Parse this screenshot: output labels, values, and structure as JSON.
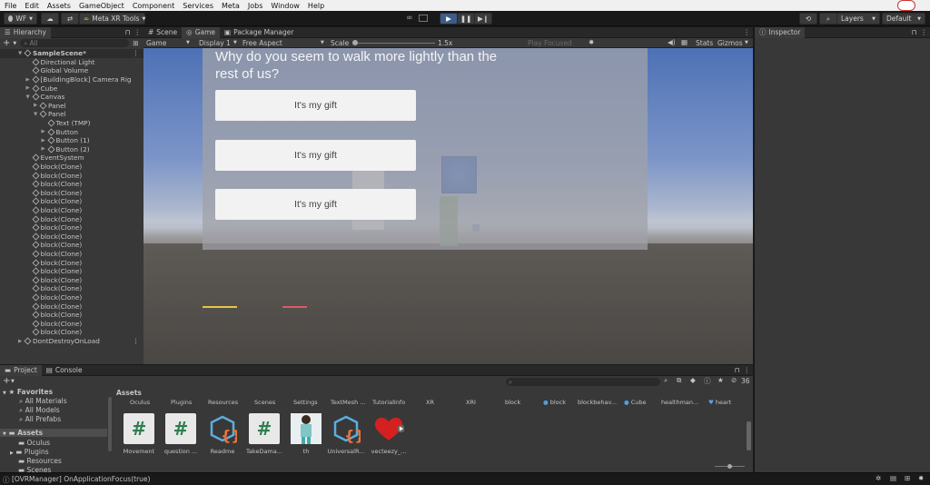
{
  "menubar": [
    "File",
    "Edit",
    "Assets",
    "GameObject",
    "Component",
    "Services",
    "Meta",
    "Jobs",
    "Window",
    "Help"
  ],
  "toolbar": {
    "account": "WF",
    "meta_tools": "Meta XR Tools",
    "layers": "Layers",
    "layout": "Default"
  },
  "hierarchy": {
    "title": "Hierarchy",
    "search": "All",
    "rows": [
      {
        "label": "SampleScene*",
        "indent": 0,
        "arrow": "▼",
        "bold": true
      },
      {
        "label": "Directional Light",
        "indent": 1,
        "arrow": ""
      },
      {
        "label": "Global Volume",
        "indent": 1,
        "arrow": ""
      },
      {
        "label": "[BuildingBlock] Camera Rig",
        "indent": 1,
        "arrow": "▶"
      },
      {
        "label": "Cube",
        "indent": 1,
        "arrow": "▶"
      },
      {
        "label": "Canvas",
        "indent": 1,
        "arrow": "▼"
      },
      {
        "label": "Panel",
        "indent": 2,
        "arrow": "▶"
      },
      {
        "label": "Panel",
        "indent": 2,
        "arrow": "▼"
      },
      {
        "label": "Text (TMP)",
        "indent": 3,
        "arrow": ""
      },
      {
        "label": "Button",
        "indent": 3,
        "arrow": "▶"
      },
      {
        "label": "Button (1)",
        "indent": 3,
        "arrow": "▶"
      },
      {
        "label": "Button (2)",
        "indent": 3,
        "arrow": "▶"
      },
      {
        "label": "EventSystem",
        "indent": 1,
        "arrow": ""
      },
      {
        "label": "block(Clone)",
        "indent": 1,
        "arrow": ""
      },
      {
        "label": "block(Clone)",
        "indent": 1,
        "arrow": ""
      },
      {
        "label": "block(Clone)",
        "indent": 1,
        "arrow": ""
      },
      {
        "label": "block(Clone)",
        "indent": 1,
        "arrow": ""
      },
      {
        "label": "block(Clone)",
        "indent": 1,
        "arrow": ""
      },
      {
        "label": "block(Clone)",
        "indent": 1,
        "arrow": ""
      },
      {
        "label": "block(Clone)",
        "indent": 1,
        "arrow": ""
      },
      {
        "label": "block(Clone)",
        "indent": 1,
        "arrow": ""
      },
      {
        "label": "block(Clone)",
        "indent": 1,
        "arrow": ""
      },
      {
        "label": "block(Clone)",
        "indent": 1,
        "arrow": ""
      },
      {
        "label": "block(Clone)",
        "indent": 1,
        "arrow": ""
      },
      {
        "label": "block(Clone)",
        "indent": 1,
        "arrow": ""
      },
      {
        "label": "block(Clone)",
        "indent": 1,
        "arrow": ""
      },
      {
        "label": "block(Clone)",
        "indent": 1,
        "arrow": ""
      },
      {
        "label": "block(Clone)",
        "indent": 1,
        "arrow": ""
      },
      {
        "label": "block(Clone)",
        "indent": 1,
        "arrow": ""
      },
      {
        "label": "block(Clone)",
        "indent": 1,
        "arrow": ""
      },
      {
        "label": "block(Clone)",
        "indent": 1,
        "arrow": ""
      },
      {
        "label": "block(Clone)",
        "indent": 1,
        "arrow": ""
      },
      {
        "label": "block(Clone)",
        "indent": 1,
        "arrow": ""
      },
      {
        "label": "DontDestroyOnLoad",
        "indent": 0,
        "arrow": "▶"
      }
    ]
  },
  "scene_tabs": {
    "scene": "Scene",
    "game": "Game",
    "package_manager": "Package Manager"
  },
  "game_bar": {
    "mode": "Game",
    "display": "Display 1",
    "aspect": "Free Aspect",
    "scale_label": "Scale",
    "scale_value": "1.5x",
    "play_focused": "Play Focused",
    "stats": "Stats",
    "gizmos": "Gizmos"
  },
  "game_ui": {
    "question": "Why do you seem to walk more lightly than the rest of us?",
    "buttons": [
      "It's my gift",
      "It's my gift",
      "It's my gift"
    ]
  },
  "inspector": {
    "title": "Inspector"
  },
  "project": {
    "tab_project": "Project",
    "tab_console": "Console",
    "assets_title": "Assets",
    "badge_count": "36",
    "favorites_label": "Favorites",
    "favorites": [
      "All Materials",
      "All Models",
      "All Prefabs"
    ],
    "tree_assets": "Assets",
    "tree": [
      "Oculus",
      "Plugins",
      "Resources",
      "Scenes"
    ],
    "folders": [
      "Oculus",
      "Plugins",
      "Resources",
      "Scenes",
      "Settings",
      "TextMesh ...",
      "TutorialInfo",
      "XR",
      "XRI",
      "block",
      "block",
      "blockbehav...",
      "Cube",
      "healthman...",
      "heart"
    ],
    "assets": [
      {
        "label": "Movement",
        "icon": "csharp-icon"
      },
      {
        "label": "question ...",
        "icon": "csharp-icon"
      },
      {
        "label": "Readme",
        "icon": "scriptable-icon"
      },
      {
        "label": "TakeDama...",
        "icon": "csharp-icon"
      },
      {
        "label": "th",
        "icon": "image-icon"
      },
      {
        "label": "UniversalR...",
        "icon": "scriptable-icon"
      },
      {
        "label": "vecteezy_...",
        "icon": "heart-icon"
      }
    ]
  },
  "status": {
    "message": "[OVRManager] OnApplicationFocus(true)"
  }
}
